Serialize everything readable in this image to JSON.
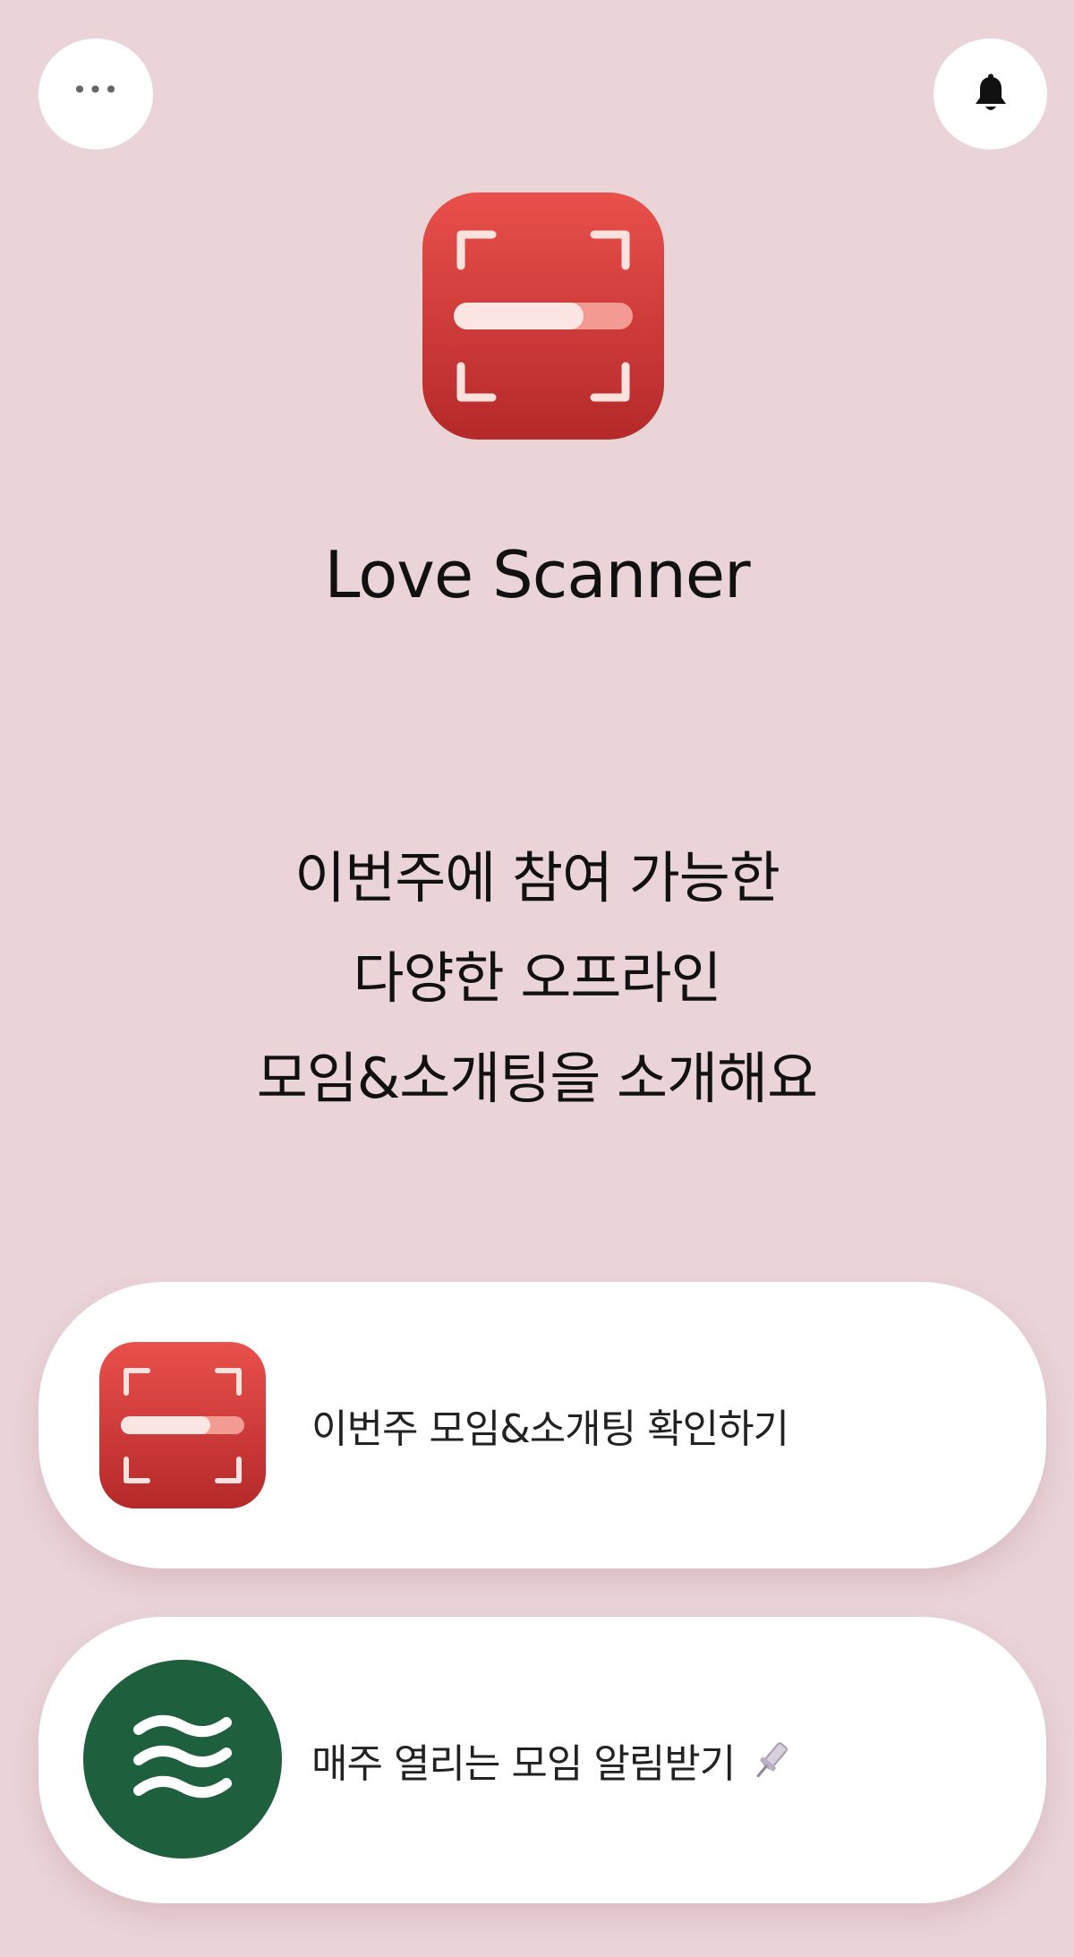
{
  "header": {
    "more_icon": "more-horizontal-icon",
    "notification_icon": "bell-icon"
  },
  "app": {
    "icon": "scanner-app-icon",
    "title": "Love Scanner"
  },
  "headline": {
    "line1": "이번주에 참여 가능한",
    "line2": "다양한 오프라인",
    "line3": "모임&소개팅을 소개해요"
  },
  "cards": [
    {
      "label": "이번주 모임&소개팅 확인하기",
      "icon": "scanner-app-icon"
    },
    {
      "label": "매주 열리는 모임 알림받기",
      "icon": "waves-logo-icon",
      "trailing_icon": "pin-icon"
    }
  ],
  "colors": {
    "background": "#EAD4D8",
    "card_background": "#FFFFFF",
    "scanner_red": "#D63A38",
    "waves_green": "#1E5F3E"
  }
}
